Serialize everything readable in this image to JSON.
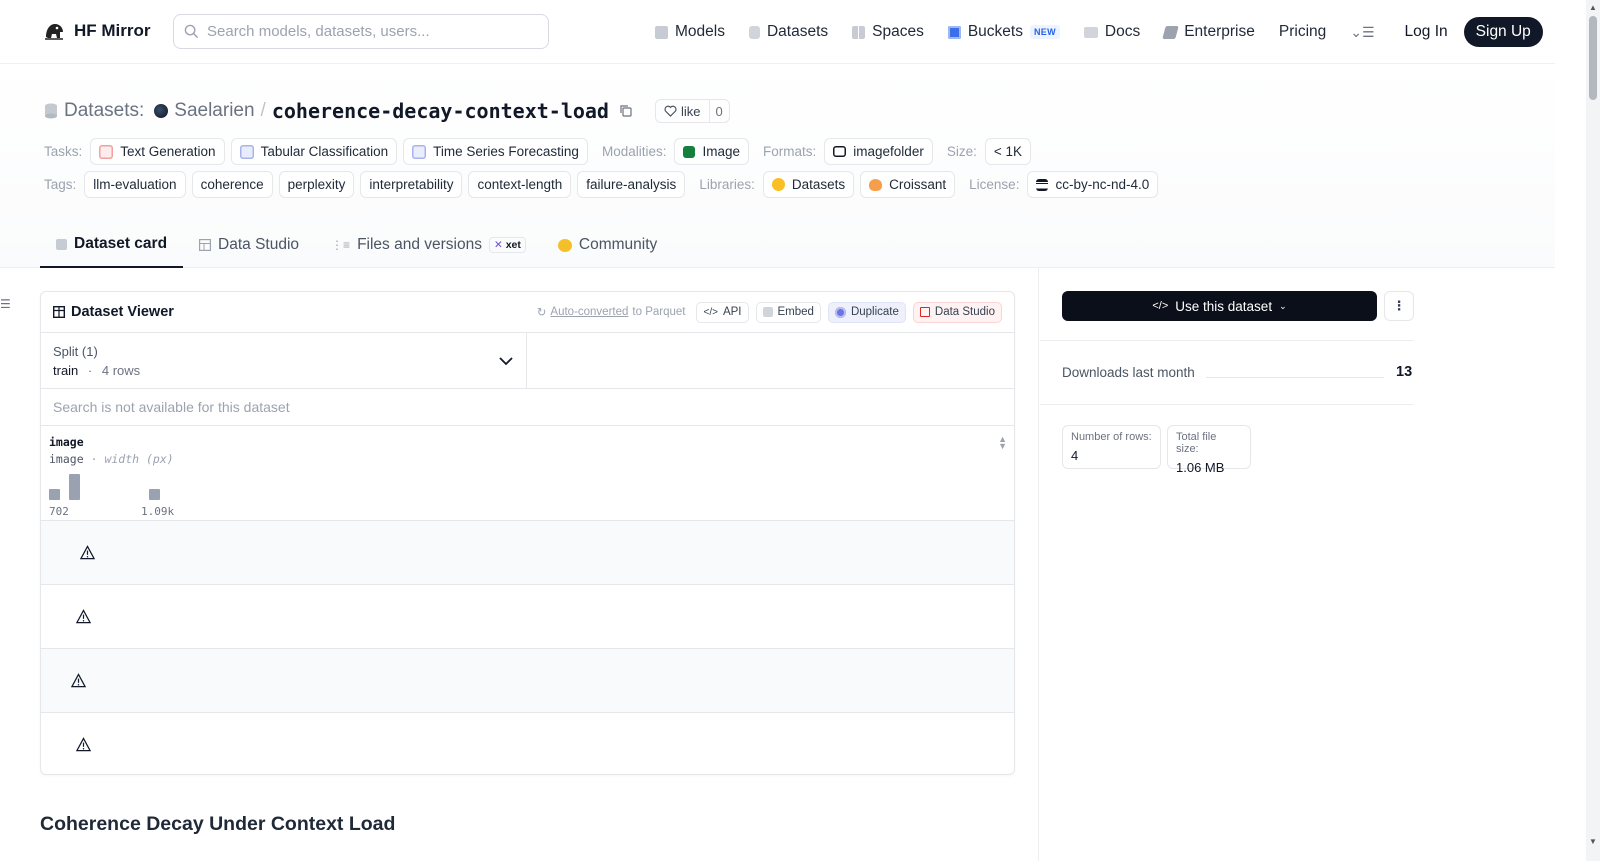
{
  "header": {
    "brand": "HF Mirror",
    "search_placeholder": "Search models, datasets, users...",
    "nav": [
      {
        "label": "Models",
        "icon": "model-cube-icon"
      },
      {
        "label": "Datasets",
        "icon": "database-icon"
      },
      {
        "label": "Spaces",
        "icon": "spaces-grid-icon"
      },
      {
        "label": "Buckets",
        "icon": "bucket-icon",
        "badge": "NEW"
      },
      {
        "label": "Docs",
        "icon": "book-icon"
      },
      {
        "label": "Enterprise",
        "icon": "enterprise-icon"
      },
      {
        "label": "Pricing"
      }
    ],
    "login": "Log In",
    "signup": "Sign Up"
  },
  "repo": {
    "type_label": "Datasets:",
    "owner": "Saelarien",
    "separator": "/",
    "name": "coherence-decay-context-load",
    "like_label": "like",
    "like_count": "0"
  },
  "meta": {
    "tasks_label": "Tasks:",
    "tasks": [
      "Text Generation",
      "Tabular Classification",
      "Time Series Forecasting"
    ],
    "modalities_label": "Modalities:",
    "modalities": [
      "Image"
    ],
    "formats_label": "Formats:",
    "formats": [
      "imagefolder"
    ],
    "size_label": "Size:",
    "size": "< 1K",
    "tags_label": "Tags:",
    "tags": [
      "llm-evaluation",
      "coherence",
      "perplexity",
      "interpretability",
      "context-length",
      "failure-analysis"
    ],
    "libraries_label": "Libraries:",
    "libraries": [
      "Datasets",
      "Croissant"
    ],
    "license_label": "License:",
    "license": "cc-by-nc-nd-4.0"
  },
  "tabs": [
    {
      "label": "Dataset card",
      "active": true
    },
    {
      "label": "Data Studio"
    },
    {
      "label": "Files and versions",
      "badge": "xet"
    },
    {
      "label": "Community"
    }
  ],
  "viewer": {
    "title": "Dataset Viewer",
    "auto_converted_link": "Auto-converted",
    "auto_converted_rest": "to Parquet",
    "api": "API",
    "embed": "Embed",
    "duplicate": "Duplicate",
    "data_studio": "Data Studio",
    "split_label": "Split (1)",
    "split_value": "train",
    "split_sep": "·",
    "split_rows": "4 rows",
    "search_unavailable": "Search is not available for this dataset",
    "column": {
      "name": "image",
      "type": "image",
      "type_sep": "·",
      "type_note": "width (px)",
      "hist_min": "702",
      "hist_max": "1.09k",
      "hist_values": [
        1,
        2,
        0,
        0,
        0,
        1
      ]
    },
    "row_count": 4
  },
  "section_title": "Coherence Decay Under Context Load",
  "sidebar": {
    "use_button": "Use this dataset",
    "downloads_label": "Downloads last month",
    "downloads_value": "13",
    "rows_label": "Number of rows:",
    "rows_value": "4",
    "filesize_label": "Total file size:",
    "filesize_value": "1.06 MB"
  }
}
